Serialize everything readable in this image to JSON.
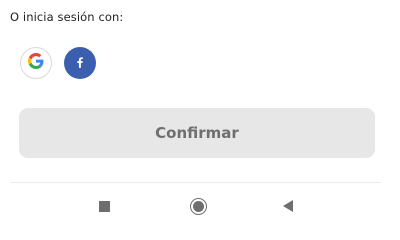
{
  "social_login": {
    "label": "O inicia sesión con:",
    "providers": [
      {
        "name": "Google",
        "icon": "google-icon",
        "letter": "G"
      },
      {
        "name": "Facebook",
        "icon": "facebook-icon",
        "letter": "f",
        "color": "#3b5fae"
      }
    ]
  },
  "confirm_button": {
    "label": "Confirmar",
    "state": "disabled"
  },
  "nav_bar": {
    "buttons": [
      {
        "name": "recents",
        "icon": "square-icon"
      },
      {
        "name": "home",
        "icon": "circle-icon"
      },
      {
        "name": "back",
        "icon": "triangle-back-icon"
      }
    ]
  }
}
